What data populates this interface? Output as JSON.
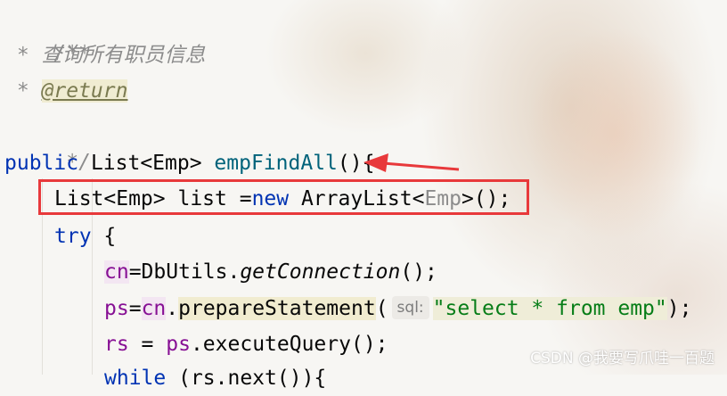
{
  "code": {
    "line1": "/**",
    "line2_star": " * ",
    "line2_text": "查询所有职员信息",
    "line3_star": " * ",
    "line3_tag": "@return",
    "line4": " */",
    "line5": {
      "kw": "public",
      "type": " List<Emp> ",
      "method": "empFindAll",
      "rest": "(){"
    },
    "line6": {
      "a": "List<Emp> list =",
      "kw": "new",
      "b": " ArrayList<",
      "generic": "Emp",
      "c": ">();"
    },
    "line7": {
      "kw": "try",
      "rest": " {"
    },
    "line8": {
      "var": "cn",
      "eq": "=DbUtils.",
      "method": "getConnection",
      "rest": "();"
    },
    "line9": {
      "var": "ps",
      "eq": "=",
      "var2": "cn",
      "dot": ".",
      "method": "prepareStatement",
      "open": "(",
      "hint": "sql:",
      "string": "\"select * from emp\"",
      "close": ");"
    },
    "line10": {
      "var": "rs",
      "eq": " = ",
      "var2": "ps",
      "rest": ".executeQuery();"
    },
    "line11": {
      "kw": "while",
      "rest": " (rs.next()){"
    }
  },
  "watermark": "CSDN @我要写爪哇一百题",
  "colors": {
    "keyword": "#0033b3",
    "method": "#00627a",
    "field": "#871094",
    "string": "#067d17",
    "comment": "#8c8c8c",
    "highlight_box": "#e8393b"
  }
}
